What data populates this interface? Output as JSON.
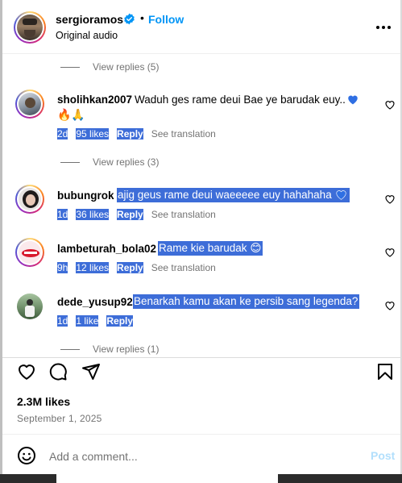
{
  "colors": {
    "accent": "#0095f6",
    "selection": "#3d6dd8",
    "secondary_text": "#737373",
    "heart_blue": "#2f6fe3",
    "post_disabled": "#b2dffc"
  },
  "header": {
    "username": "sergioramos",
    "separator": "•",
    "follow_label": "Follow",
    "audio_label": "Original audio",
    "icons": {
      "verified": "verified-badge-icon",
      "more": "more-options-icon"
    }
  },
  "comments": {
    "view_replies_top": "View replies (5)",
    "items": [
      {
        "username": "sholihkan2007",
        "text_line1": "Waduh ges rame deui Bae ye barudak euy..",
        "emoji_line2": "🔥🙏",
        "time": "2d",
        "likes": "95 likes",
        "reply_label": "Reply",
        "translate_label": "See translation",
        "view_replies": "View replies (3)"
      },
      {
        "username": "bubungrok",
        "text": "ajig geus rame deui waeeeee euy hahahaha",
        "time": "1d",
        "likes": "36 likes",
        "reply_label": "Reply",
        "translate_label": "See translation"
      },
      {
        "username": "lambeturah_bola02",
        "text": "Rame kie barudak",
        "emoji": "😊",
        "time": "9h",
        "likes": "12 likes",
        "reply_label": "Reply",
        "translate_label": "See translation"
      },
      {
        "username": "dede_yusup92",
        "text": "Benarkah kamu akan ke persib sang legenda?",
        "time": "1d",
        "likes": "1 like",
        "reply_label": "Reply",
        "view_replies": "View replies (1)"
      }
    ]
  },
  "actions": {
    "icons": [
      "heart-icon",
      "comment-icon",
      "share-icon",
      "bookmark-icon"
    ],
    "likes_count": "2.3M likes",
    "date": "September 1, 2025"
  },
  "composer": {
    "placeholder": "Add a comment...",
    "post_label": "Post",
    "emoji_icon": "emoji-icon"
  }
}
